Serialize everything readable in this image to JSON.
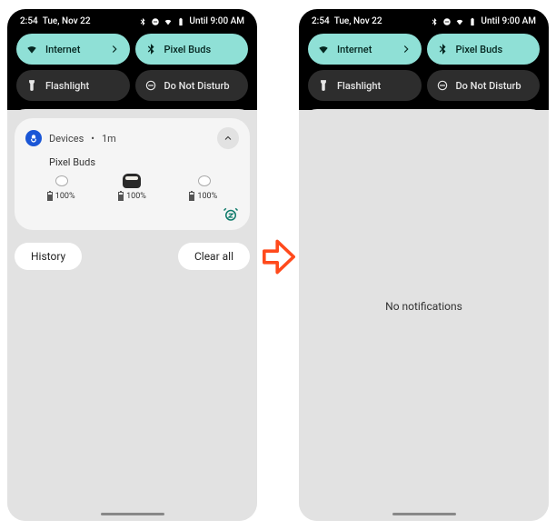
{
  "status": {
    "time": "2:54",
    "date": "Tue, Nov 22",
    "alarm_label": "Until 9:00 AM"
  },
  "qs": {
    "internet": "Internet",
    "pixelbuds": "Pixel Buds",
    "flashlight": "Flashlight",
    "dnd": "Do Not Disturb"
  },
  "notif": {
    "app": "Devices",
    "age": "1m",
    "sep": " • ",
    "title": "Pixel Buds",
    "buds": [
      {
        "pct": "100%"
      },
      {
        "pct": "100%"
      },
      {
        "pct": "100%"
      }
    ]
  },
  "actions": {
    "history": "History",
    "clearall": "Clear all"
  },
  "empty": {
    "msg": "No notifications"
  }
}
